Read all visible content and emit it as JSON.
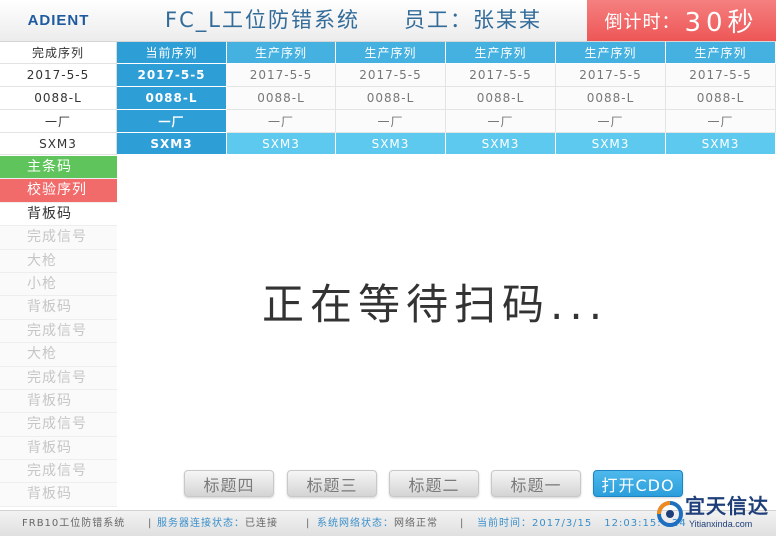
{
  "header": {
    "logo": "ADIENT",
    "title": "FC_L工位防错系统",
    "employee": "员工：张某某",
    "countdown_label": "倒计时：",
    "countdown_value": "30秒"
  },
  "table": {
    "left_column": [
      "完成序列",
      "2017-5-5",
      "0088-L",
      "一厂",
      "SXM3"
    ],
    "columns": [
      {
        "header": "当前序列",
        "cells": [
          "2017-5-5",
          "0088-L",
          "一厂",
          "SXM3"
        ]
      },
      {
        "header": "生产序列",
        "cells": [
          "2017-5-5",
          "0088-L",
          "一厂",
          "SXM3"
        ]
      },
      {
        "header": "生产序列",
        "cells": [
          "2017-5-5",
          "0088-L",
          "一厂",
          "SXM3"
        ]
      },
      {
        "header": "生产序列",
        "cells": [
          "2017-5-5",
          "0088-L",
          "一厂",
          "SXM3"
        ]
      },
      {
        "header": "生产序列",
        "cells": [
          "2017-5-5",
          "0088-L",
          "一厂",
          "SXM3"
        ]
      },
      {
        "header": "生产序列",
        "cells": [
          "2017-5-5",
          "0088-L",
          "一厂",
          "SXM3"
        ]
      }
    ]
  },
  "sidebar": {
    "items": [
      {
        "label": "主条码",
        "bg": "#5ec45b",
        "fg": "#ffffff"
      },
      {
        "label": "校验序列",
        "bg": "#f26b6b",
        "fg": "#ffffff"
      },
      {
        "label": "背板码",
        "bg": "#ffffff",
        "fg": "#333333"
      },
      {
        "label": "完成信号",
        "bg": "#fafafa",
        "fg": "#c6c6c6"
      },
      {
        "label": "大枪",
        "bg": "#fafafa",
        "fg": "#c6c6c6"
      },
      {
        "label": "小枪",
        "bg": "#fafafa",
        "fg": "#c6c6c6"
      },
      {
        "label": "背板码",
        "bg": "#fafafa",
        "fg": "#c6c6c6"
      },
      {
        "label": "完成信号",
        "bg": "#fafafa",
        "fg": "#c6c6c6"
      },
      {
        "label": "大枪",
        "bg": "#fafafa",
        "fg": "#c6c6c6"
      },
      {
        "label": "完成信号",
        "bg": "#fafafa",
        "fg": "#c6c6c6"
      },
      {
        "label": "背板码",
        "bg": "#fafafa",
        "fg": "#c6c6c6"
      },
      {
        "label": "完成信号",
        "bg": "#fafafa",
        "fg": "#c6c6c6"
      },
      {
        "label": "背板码",
        "bg": "#fafafa",
        "fg": "#c6c6c6"
      },
      {
        "label": "完成信号",
        "bg": "#fafafa",
        "fg": "#c6c6c6"
      },
      {
        "label": "背板码",
        "bg": "#fafafa",
        "fg": "#c6c6c6"
      }
    ]
  },
  "main": {
    "message": "正在等待扫码..."
  },
  "buttons": [
    {
      "label": "标题四"
    },
    {
      "label": "标题三"
    },
    {
      "label": "标题二"
    },
    {
      "label": "标题一"
    },
    {
      "label": "打开CDO"
    }
  ],
  "footer": {
    "system_name": "FRB10工位防错系统",
    "separator": "|",
    "server_label": "服务器连接状态：",
    "server_value": "已连接",
    "network_label": "系统网络状态：",
    "network_value": "网络正常",
    "time_label": "当前时间：",
    "date": "2017/3/15",
    "time": "12:03:15:",
    "time_tail": "24"
  },
  "watermark": {
    "name": "宜天信达",
    "site": "Yitianxinda.com"
  },
  "colors": {
    "current": "#2d9ed6",
    "production_header": "#45b1e1",
    "production_highlight": "#5dc9ef",
    "countdown": "#ee5656",
    "title": "#336b99",
    "footer_label": "#3a8fca",
    "primary_button": "#2a9edc"
  }
}
